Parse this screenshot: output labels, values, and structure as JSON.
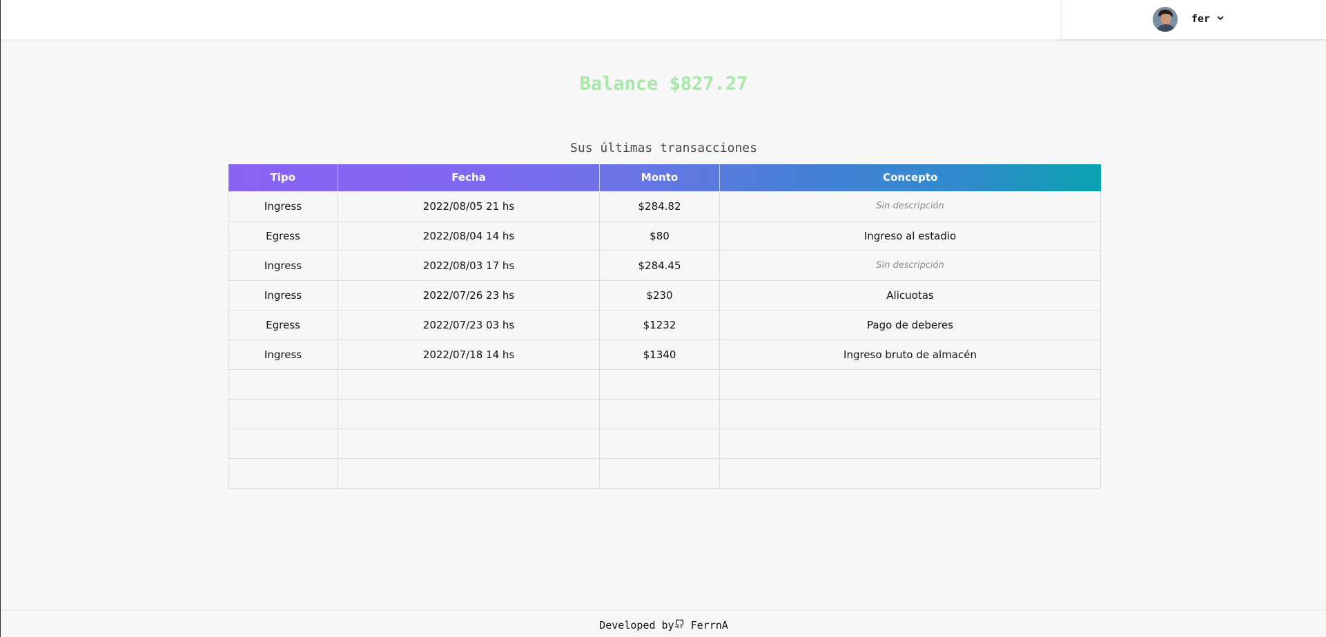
{
  "header": {
    "username": "fer",
    "avatar_icon": "user-avatar",
    "menu_icon": "chevron-down-icon"
  },
  "balance": {
    "text": "Balance $827.27",
    "color": "#a6e8a6"
  },
  "transactions": {
    "title": "Sus últimas transacciones",
    "columns": [
      "Tipo",
      "Fecha",
      "Monto",
      "Concepto"
    ],
    "rows": [
      {
        "tipo": "Ingress",
        "fecha": "2022/08/05 21 hs",
        "monto": "$284.82",
        "concepto": "Sin descripción",
        "empty": true
      },
      {
        "tipo": "Egress",
        "fecha": "2022/08/04 14 hs",
        "monto": "$80",
        "concepto": "Ingreso al estadio",
        "empty": false
      },
      {
        "tipo": "Ingress",
        "fecha": "2022/08/03 17 hs",
        "monto": "$284.45",
        "concepto": "Sin descripción",
        "empty": true
      },
      {
        "tipo": "Ingress",
        "fecha": "2022/07/26 23 hs",
        "monto": "$230",
        "concepto": "Alicuotas",
        "empty": false
      },
      {
        "tipo": "Egress",
        "fecha": "2022/07/23 03 hs",
        "monto": "$1232",
        "concepto": "Pago de deberes",
        "empty": false
      },
      {
        "tipo": "Ingress",
        "fecha": "2022/07/18 14 hs",
        "monto": "$1340",
        "concepto": "Ingreso bruto de almacén",
        "empty": false
      }
    ],
    "blank_rows": 4,
    "header_gradient": [
      "#8b63f3",
      "#0aa3b0"
    ]
  },
  "footer": {
    "prefix": "Developed by",
    "icon": "github-icon",
    "author": "FerrnA"
  }
}
